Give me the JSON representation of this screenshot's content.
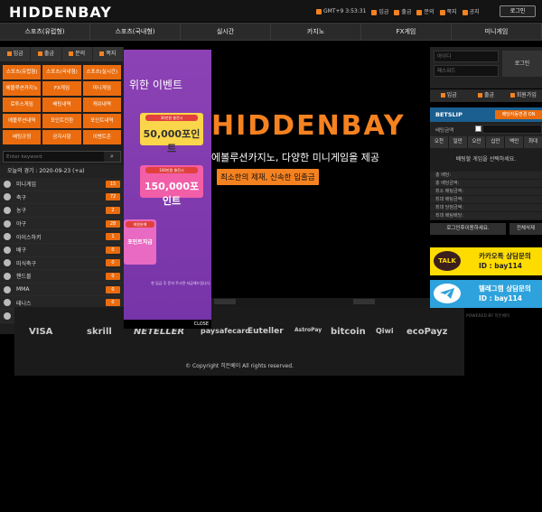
{
  "header": {
    "logo_main": "HIDDENBAY",
    "clock": "GMT+9 3:53:31",
    "links": [
      "입금",
      "출금",
      "문의",
      "쪽지",
      "공지"
    ],
    "login": "로그인"
  },
  "nav": [
    "스포츠(유럽형)",
    "스포츠(국내형)",
    "실시간",
    "카지노",
    "FX게임",
    "미니게임"
  ],
  "left": {
    "quick": [
      "입금",
      "출금",
      "문의",
      "쪽지"
    ],
    "grid": [
      "스포츠(유럽형)",
      "스포츠(국내형)",
      "스포츠(실시간)",
      "에볼루션카지노",
      "FX게임",
      "미니게임",
      "로투스게임",
      "배팅내역",
      "캐쉬내역",
      "에볼루션내역",
      "포인트전환",
      "포인트내역",
      "배팅규정",
      "공지사항",
      "이벤트존"
    ],
    "keyword_placeholder": "Enter keyword",
    "today": "오늘의 경기 : 2020-09-23 (+a)",
    "sports": [
      {
        "name": "미니게임",
        "count": "15"
      },
      {
        "name": "축구",
        "count": "72"
      },
      {
        "name": "농구",
        "count": "2"
      },
      {
        "name": "야구",
        "count": "28"
      },
      {
        "name": "아이스하키",
        "count": "1"
      },
      {
        "name": "배구",
        "count": "0"
      },
      {
        "name": "미식축구",
        "count": "0"
      },
      {
        "name": "핸드볼",
        "count": "0"
      },
      {
        "name": "MMA",
        "count": "0"
      },
      {
        "name": "테니스",
        "count": "0"
      },
      {
        "name": "eSports",
        "count": "1"
      }
    ]
  },
  "popup": {
    "title": "위한 이벤트",
    "env1_cap": "30만원 충전시",
    "env1_amt": "50,000포인트",
    "env2_cap": "100만원 충전시",
    "env2_amt": "150,000포인트",
    "env3_cap": "회원분께",
    "env3_amt": "포인트지급",
    "note": "첫 입금 후 문의 주시면 지급해드립니다.",
    "close": "CLOSE"
  },
  "hero": {
    "brand": "HIDDENBAY",
    "tagline": "에볼루션카지노, 다양한 미니게임을 제공",
    "sub": "최소한의 제재, 신속한 입출금"
  },
  "payments": [
    "VISA",
    "skrill",
    "NETELLER",
    "paysafecard",
    "Euteller",
    "AstroPay",
    "bitcoin",
    "Qiwi",
    "ecoPayz"
  ],
  "copyright": "© Copyright 히든베이 All rights reserved.",
  "right": {
    "id_placeholder": "아이디",
    "pw_placeholder": "패스워드",
    "login": "로그인",
    "quick": [
      "입금",
      "출금",
      "회원가입"
    ],
    "betslip_title": "BETSLIP",
    "betslip_btn": "배당자동변경 ON",
    "bet_amount_label": "배팅금액",
    "tabs": [
      "오천",
      "일만",
      "오만",
      "십만",
      "백만",
      "최대"
    ],
    "empty": "배팅할 게임을 선택하세요.",
    "rows": [
      "총 배당:",
      "총 배당금액:",
      "최소 배팅금액:",
      "최대 배팅금액:",
      "최대 당첨금액:",
      "최대 배팅배당:"
    ],
    "cart_btn": "로그인후이용하세요.",
    "clear_btn": "전체삭제",
    "kakao_line1": "카카오톡 상담문의",
    "kakao_line2": "ID : bay114",
    "kakao_badge": "TALK",
    "tele_line1": "텔레그램 상담문의",
    "tele_line2": "ID : bay114",
    "powered": "POWERED BY 히든베이"
  },
  "colors": {
    "accent": "#f58220",
    "orange_tile": "#ea6c0e",
    "betslip": "#1a5f8f",
    "kakao": "#fedc00",
    "telegram": "#2ea2dc"
  }
}
